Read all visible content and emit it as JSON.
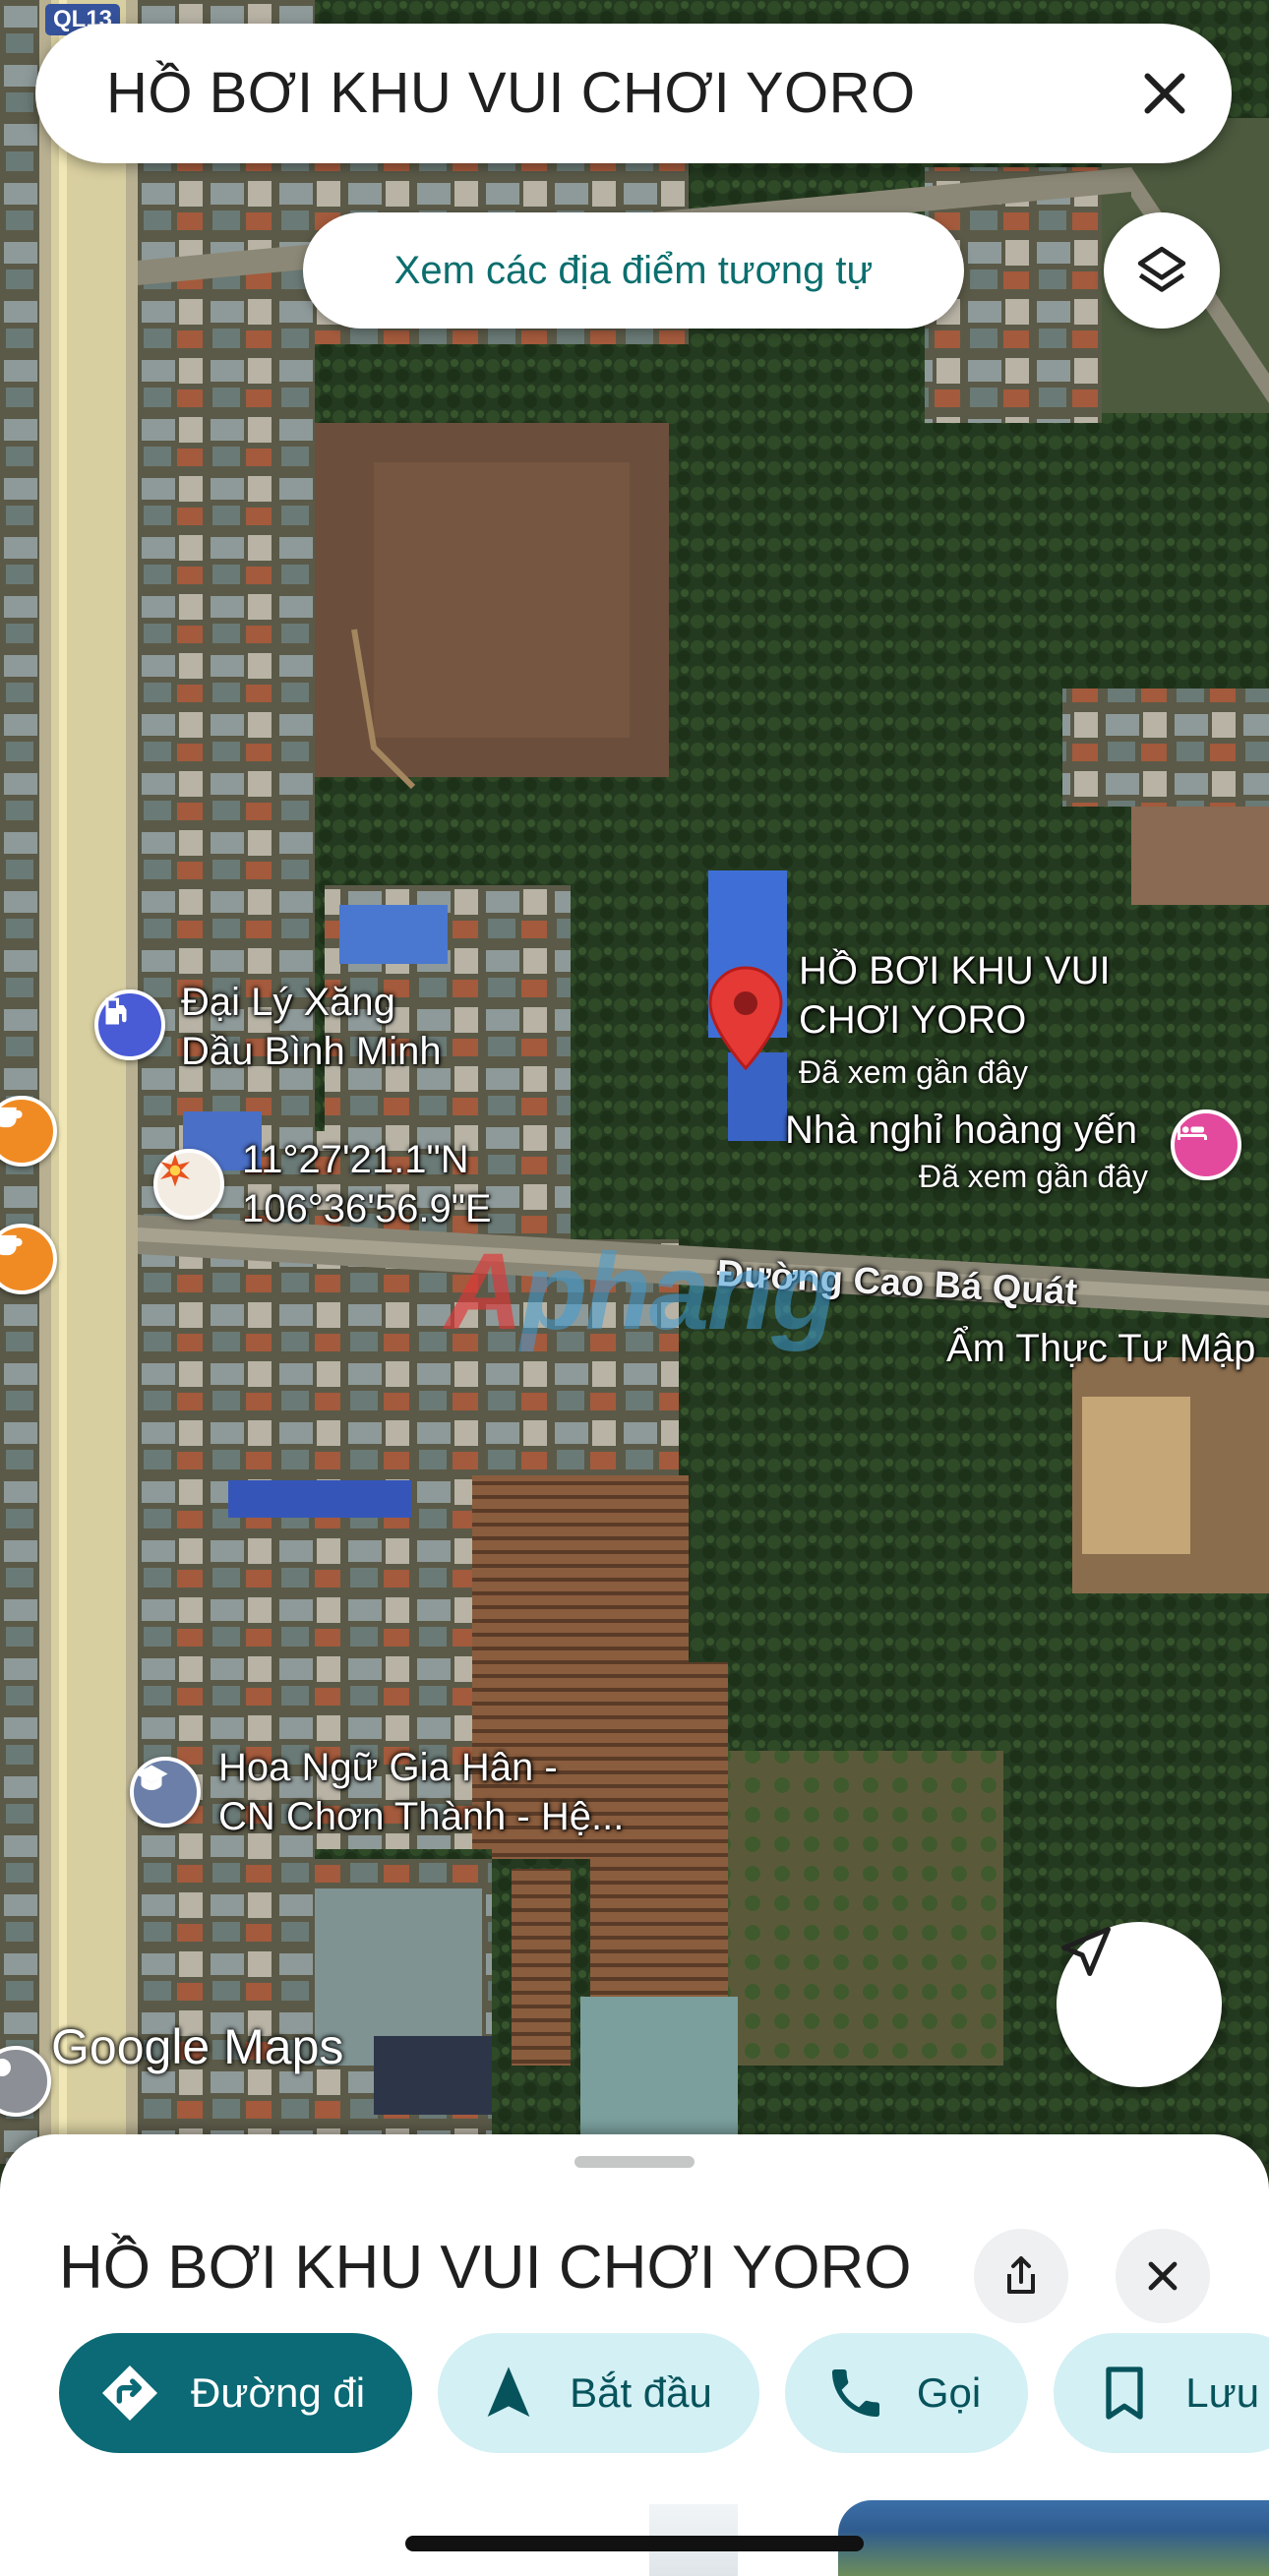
{
  "search": {
    "query": "HỒ BƠI KHU VUI CHƠI YORO",
    "similar_places_label": "Xem các địa điểm tương tự"
  },
  "map": {
    "road_badge": "QL13",
    "place_pin": {
      "name_line1": "HỒ BƠI KHU VUI",
      "name_line2": "CHƠI YORO",
      "status": "Đã xem gần đây"
    },
    "pois": [
      {
        "line1": "Đại Lý Xăng",
        "line2": "Dầu Bình Minh",
        "icon": "gas-station-icon",
        "color": "#4a5bd6"
      },
      {
        "line1": "11°27'21.1\"N",
        "line2": "106°36'56.9\"E",
        "icon": "coordinate-marker-icon"
      },
      {
        "line1": "Nhà nghỉ hoàng yến",
        "line2": "Đã xem gần đây",
        "icon": "hotel-bed-icon",
        "color": "#e34a9d"
      },
      {
        "line1": "Đường Cao Bá Quát",
        "icon": "road-label"
      },
      {
        "line1": "Ẩm Thực Tư Mập",
        "icon": "restaurant-label"
      },
      {
        "line1": "Hoa Ngữ Gia Hân -",
        "line2": "CN Chơn Thành - Hệ...",
        "icon": "school-icon",
        "color": "#6b7fa8"
      }
    ],
    "side_pins": [
      {
        "icon": "cafe-icon",
        "color": "#f08b24"
      },
      {
        "icon": "cafe-icon",
        "color": "#f08b24"
      }
    ],
    "watermark": {
      "part1": "A",
      "part2": "phang"
    },
    "attribution": "Google Maps"
  },
  "sheet": {
    "title": "HỒ BƠI KHU VUI CHƠI YORO",
    "actions": [
      {
        "label": "Đường đi",
        "icon": "directions-icon",
        "primary": true
      },
      {
        "label": "Bắt đầu",
        "icon": "navigation-arrow-icon"
      },
      {
        "label": "Gọi",
        "icon": "phone-icon"
      },
      {
        "label": "Lưu",
        "icon": "bookmark-icon"
      }
    ]
  },
  "colors": {
    "accent": "#0b6a75",
    "chip_bg": "#d3f0f4",
    "pin_red": "#e53935",
    "teal_text": "#0b6e6e"
  }
}
